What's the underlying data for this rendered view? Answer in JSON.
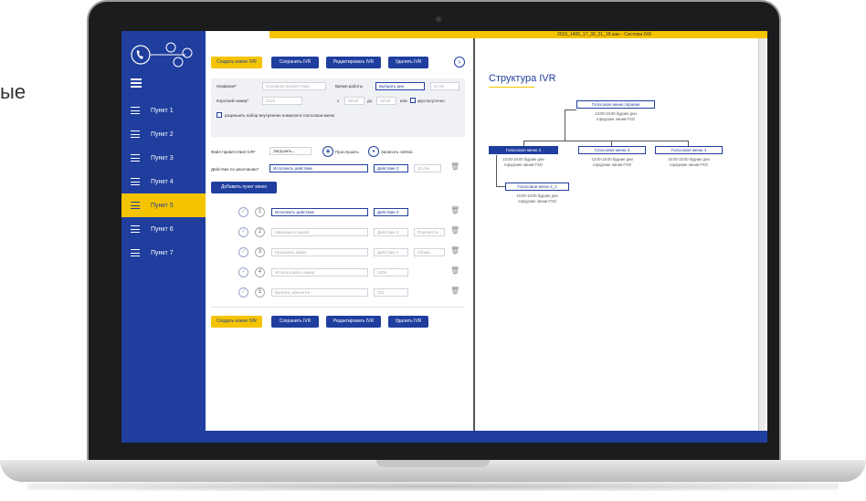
{
  "side_text": "ые",
  "app": {
    "window_title": "2015_1406_17_30_21_18.wav - Система IVR",
    "colors": {
      "brand_blue": "#1f3e9e",
      "accent_yellow": "#f5c400"
    },
    "logo_icon": "phone-ivr-logo",
    "sidebar": {
      "items": [
        {
          "label": "Пункт 1",
          "active": false
        },
        {
          "label": "Пункт 2",
          "active": false
        },
        {
          "label": "Пункт 3",
          "active": false
        },
        {
          "label": "Пункт 4",
          "active": false
        },
        {
          "label": "Пункт 5",
          "active": true
        },
        {
          "label": "Пункт 6",
          "active": false
        },
        {
          "label": "Пункт 7",
          "active": false
        }
      ]
    },
    "toolbar": {
      "create": "Создать новое IVR",
      "save": "Сохранить IVR",
      "edit": "Редактировать IVR",
      "delete": "Удалить IVR",
      "next_icon": "chevron-right-icon"
    },
    "form": {
      "name_label": "Название*",
      "name_placeholder": "Основное приветствие",
      "work_time_label": "Время работы",
      "days_select": "Выбрать дни",
      "time_placeholder": "по во",
      "short_number_label": "Короткий номер*",
      "short_number_value": "2215",
      "from_label": "с",
      "from_value": "09:00",
      "to_label": "до",
      "to_value": "18:00",
      "round_clock_label": "или",
      "round_clock_text": "круглосуточно",
      "allow_dial_label": "разрешить набор внутренних номеров в голосовом меню",
      "greeting_file_label": "Файл приветствия IVR*",
      "upload_label": "Загрузить...",
      "listen_label": "Прослушать",
      "record_label": "Записать сейчас",
      "default_action_label": "Действие по умолчанию*",
      "default_action_value": "Исполнить действие",
      "default_target_value": "Действие 2",
      "default_timeout": "10 сек",
      "add_menu_item": "Добавить пункт меню"
    },
    "menu_items": [
      {
        "num": "1",
        "action": "Исполнить действие",
        "target": "Действие 2",
        "extra": "",
        "dim": false
      },
      {
        "num": "2",
        "action": "Завершить вызов",
        "target": "Действие 3",
        "extra": "Перевести...",
        "dim": true
      },
      {
        "num": "3",
        "action": "Проиграть файл",
        "target": "Действие 2",
        "extra": "Обзор...",
        "dim": true
      },
      {
        "num": "4",
        "action": "Использовать номер",
        "target": "1006",
        "extra": "",
        "dim": true
      },
      {
        "num": "5",
        "action": "Вызвать абонента",
        "target": "101",
        "extra": "",
        "dim": true
      }
    ],
    "ivr": {
      "title": "Структура IVR",
      "root": {
        "label": "Голосовое меню справки",
        "time": "13:00-18:00 будние дни",
        "line": "городские линии FXO"
      },
      "level1": [
        {
          "label": "Голосовое меню 2",
          "time": "10:00-18:00 будние дни",
          "line": "городские линии FXO",
          "active": true
        },
        {
          "label": "Голосовое меню 3",
          "time": "13:00-18:00 будние дни",
          "line": "городские линии FXO",
          "active": false
        },
        {
          "label": "Голосовое меню 4",
          "time": "10:00-18:00 будние дни",
          "line": "городские линии FXO",
          "active": false
        }
      ],
      "level2": {
        "label": "Голосовое меню 2_1",
        "time": "10:00-18:00 будние дни",
        "line": "городские линии FXO"
      }
    }
  }
}
